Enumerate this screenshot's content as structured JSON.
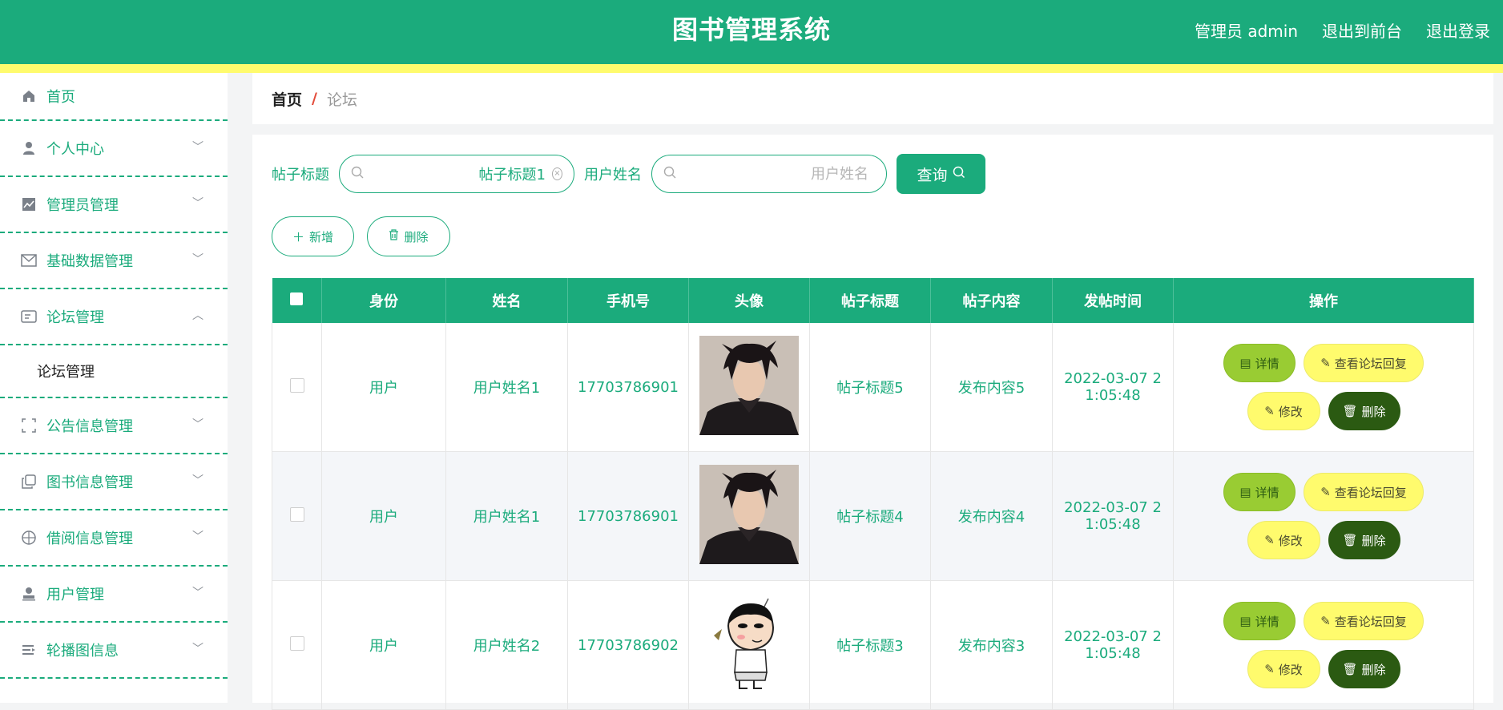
{
  "header": {
    "title": "图书管理系统",
    "user": "管理员 admin",
    "to_front": "退出到前台",
    "logout": "退出登录"
  },
  "sidebar": {
    "items": [
      {
        "label": "首页",
        "icon": "home-icon"
      },
      {
        "label": "个人中心",
        "icon": "user-icon"
      },
      {
        "label": "管理员管理",
        "icon": "chart-icon"
      },
      {
        "label": "基础数据管理",
        "icon": "mail-icon"
      },
      {
        "label": "论坛管理",
        "icon": "message-icon",
        "expanded": true
      },
      {
        "label": "公告信息管理",
        "icon": "frame-icon"
      },
      {
        "label": "图书信息管理",
        "icon": "copy-icon"
      },
      {
        "label": "借阅信息管理",
        "icon": "target-icon"
      },
      {
        "label": "用户管理",
        "icon": "user-stamp-icon"
      },
      {
        "label": "轮播图信息",
        "icon": "list-icon"
      }
    ],
    "sub_item": "论坛管理"
  },
  "breadcrumb": {
    "home": "首页",
    "sep": "/",
    "current": "论坛"
  },
  "search": {
    "title_label": "帖子标题",
    "title_value": "帖子标题1",
    "title_placeholder": "帖子标题",
    "name_label": "用户姓名",
    "name_value": "",
    "name_placeholder": "用户姓名",
    "query": "查询"
  },
  "actions": {
    "add": "新增",
    "delete": "删除"
  },
  "table": {
    "headers": [
      "身份",
      "姓名",
      "手机号",
      "头像",
      "帖子标题",
      "帖子内容",
      "发帖时间",
      "操作"
    ],
    "rows": [
      {
        "role": "用户",
        "name": "用户姓名1",
        "phone": "17703786901",
        "avatar": "male-photo",
        "title": "帖子标题5",
        "content": "发布内容5",
        "time1": "2022-03-07 2",
        "time2": "1:05:48"
      },
      {
        "role": "用户",
        "name": "用户姓名1",
        "phone": "17703786901",
        "avatar": "male-photo",
        "title": "帖子标题4",
        "content": "发布内容4",
        "time1": "2022-03-07 2",
        "time2": "1:05:48"
      },
      {
        "role": "用户",
        "name": "用户姓名2",
        "phone": "17703786902",
        "avatar": "cartoon-boy",
        "title": "帖子标题3",
        "content": "发布内容3",
        "time1": "2022-03-07 2",
        "time2": "1:05:48"
      }
    ],
    "ops": {
      "detail": "详情",
      "reply": "查看论坛回复",
      "edit": "修改",
      "delete": "删除"
    }
  },
  "colors": {
    "primary": "#1bab7c",
    "yellow": "#fffb6d",
    "lime": "#99cc33",
    "dark_green": "#2b5a12"
  }
}
